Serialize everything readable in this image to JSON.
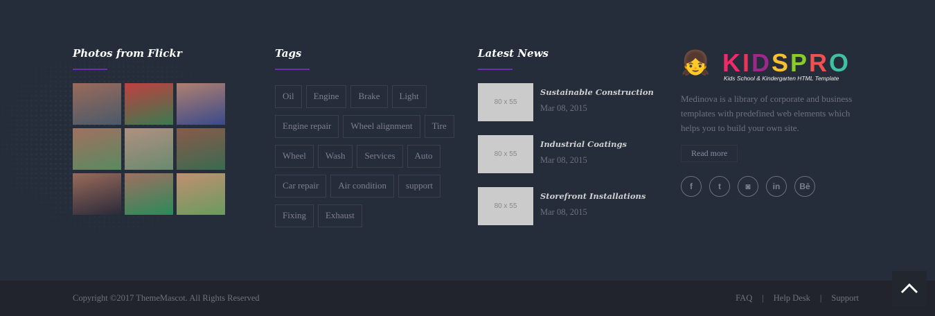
{
  "flickr": {
    "title": "Photos from Flickr",
    "photos": 9
  },
  "tags": {
    "title": "Tags",
    "items": [
      "Oil",
      "Engine",
      "Brake",
      "Light",
      "Engine repair",
      "Wheel alignment",
      "Tire",
      "Wheel",
      "Wash",
      "Services",
      "Auto",
      "Car repair",
      "Air condition",
      "support",
      "Fixing",
      "Exhaust"
    ]
  },
  "news": {
    "title": "Latest News",
    "items": [
      {
        "thumb": "80 x 55",
        "title": "Sustainable Construction",
        "date": "Mar 08, 2015"
      },
      {
        "thumb": "80 x 55",
        "title": "Industrial Coatings",
        "date": "Mar 08, 2015"
      },
      {
        "thumb": "80 x 55",
        "title": "Storefront Installations",
        "date": "Mar 08, 2015"
      }
    ]
  },
  "about": {
    "logo": "KIDSPRO",
    "tagline": "Kids School & Kindergarten HTML Template",
    "description": "Medinova is a library of corporate and business templates with predefined web elements which helps you to build your own site.",
    "read_more": "Read more",
    "social": [
      {
        "icon": "facebook-icon",
        "glyph": "f"
      },
      {
        "icon": "twitter-icon",
        "glyph": "t"
      },
      {
        "icon": "instagram-icon",
        "glyph": "◙"
      },
      {
        "icon": "linkedin-icon",
        "glyph": "in"
      },
      {
        "icon": "behance-icon",
        "glyph": "Bē"
      }
    ]
  },
  "footer": {
    "copyright": "Copyright ©2017 ThemeMascot. All Rights Reserved",
    "links": [
      "FAQ",
      "Help Desk",
      "Support"
    ],
    "separator": "|"
  },
  "colors": {
    "accent": "#6a2fb0",
    "background": "#252c3a"
  }
}
